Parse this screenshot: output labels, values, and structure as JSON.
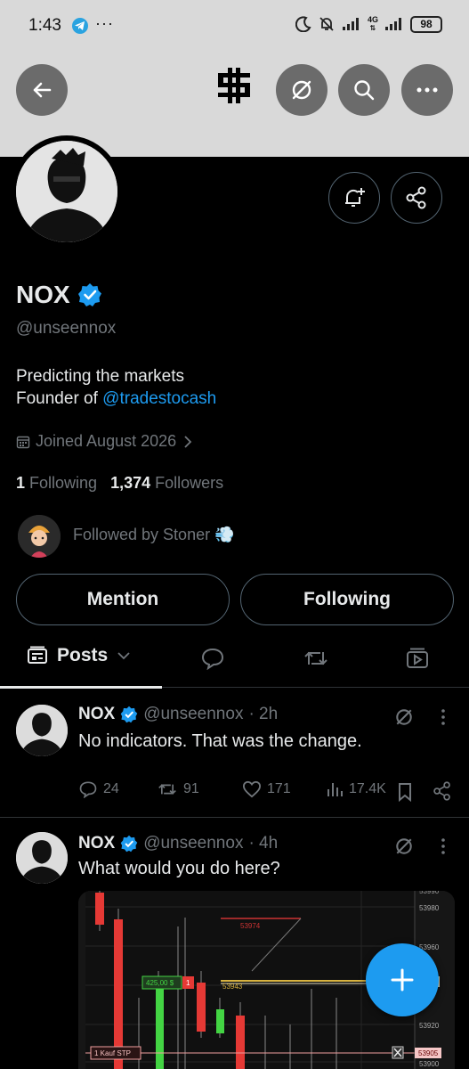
{
  "status_bar": {
    "time": "1:43",
    "network": "4G",
    "battery": "98"
  },
  "profile": {
    "name": "NOX",
    "handle": "@unseennox",
    "bio_line1": "Predicting the markets",
    "bio_line2_prefix": "Founder of ",
    "bio_link": "@tradestocash",
    "joined": "Joined August 2026",
    "following_count": "1",
    "following_label": "Following",
    "followers_count": "1,374",
    "followers_label": "Followers",
    "followed_by": "Followed by Stoner 💨"
  },
  "buttons": {
    "mention": "Mention",
    "following": "Following"
  },
  "tabs": {
    "posts": "Posts"
  },
  "posts": [
    {
      "name": "NOX",
      "handle": "@unseennox",
      "time": "· 2h",
      "text": "No indicators. That was the change.",
      "replies": "24",
      "reposts": "91",
      "likes": "171",
      "views": "17.4K"
    },
    {
      "name": "NOX",
      "handle": "@unseennox",
      "time": "· 4h",
      "text": "What would you do here?"
    }
  ],
  "chart_labels": {
    "price_53980": "53980",
    "price_53974": "53974",
    "price_53960": "53960",
    "price_53943": "53943",
    "order_price": "425,00 $",
    "order_qty": "1",
    "order_qty_2": "1",
    "price_53920": "53920",
    "stop_label": "1  Kauf STP",
    "price_53905": "53905",
    "price_53900": "53900",
    "price_top": "53990"
  },
  "colors": {
    "accent": "#1d9bf0",
    "verified": "#1d9bf0",
    "muted": "#71767b"
  }
}
